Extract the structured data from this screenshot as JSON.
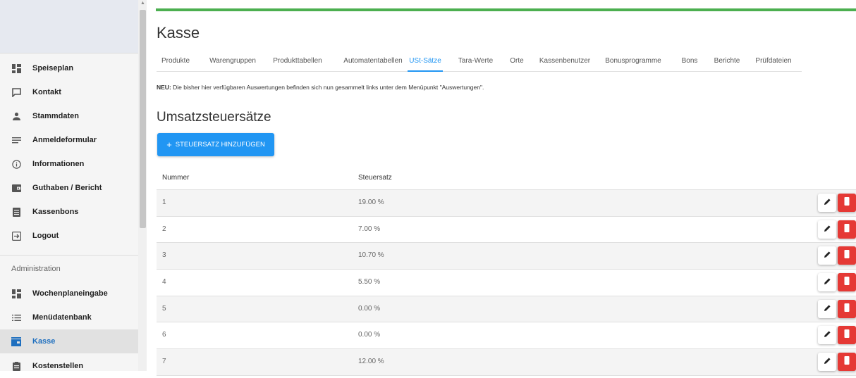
{
  "sidebar": {
    "items": [
      {
        "label": "Speiseplan",
        "icon": "dashboard-icon"
      },
      {
        "label": "Kontakt",
        "icon": "chat-icon"
      },
      {
        "label": "Stammdaten",
        "icon": "person-icon"
      },
      {
        "label": "Anmeldeformular",
        "icon": "notes-icon"
      },
      {
        "label": "Informationen",
        "icon": "info-icon"
      },
      {
        "label": "Guthaben / Bericht",
        "icon": "wallet-icon"
      },
      {
        "label": "Kassenbons",
        "icon": "receipt-icon"
      },
      {
        "label": "Logout",
        "icon": "logout-icon"
      }
    ],
    "section_label": "Administration",
    "admin_items": [
      {
        "label": "Wochenplaneingabe",
        "icon": "dashboard-icon"
      },
      {
        "label": "Menüdatenbank",
        "icon": "list-icon"
      },
      {
        "label": "Kasse",
        "icon": "store-icon"
      },
      {
        "label": "Kostenstellen",
        "icon": "clipboard-icon"
      }
    ],
    "active_item": "Kasse"
  },
  "progress": {
    "value": 100,
    "color": "#4caf50"
  },
  "page": {
    "title": "Kasse"
  },
  "tabs": [
    {
      "label": "Produkte"
    },
    {
      "label": "Warengruppen"
    },
    {
      "label": "Produkttabellen"
    },
    {
      "label": "Automatentabellen"
    },
    {
      "label": "USt-Sätze",
      "active": true
    },
    {
      "label": "Tara-Werte"
    },
    {
      "label": "Orte"
    },
    {
      "label": "Kassenbenutzer"
    },
    {
      "label": "Bonusprogramme"
    },
    {
      "label": "Bons"
    },
    {
      "label": "Berichte"
    },
    {
      "label": "Prüfdateien"
    }
  ],
  "notice": {
    "prefix": "NEU:",
    "text": "Die bisher hier verfügbaren Auswertungen befinden sich nun gesammelt links unter dem Menüpunkt \"Auswertungen\"."
  },
  "section": {
    "title": "Umsatzsteuersätze"
  },
  "add_button": {
    "label": "STEUERSATZ HINZUFÜGEN"
  },
  "table": {
    "columns": [
      "Nummer",
      "Steuersatz"
    ],
    "rows": [
      {
        "nummer": "1",
        "steuersatz": "19.00 %"
      },
      {
        "nummer": "2",
        "steuersatz": "7.00 %"
      },
      {
        "nummer": "3",
        "steuersatz": "10.70 %"
      },
      {
        "nummer": "4",
        "steuersatz": "5.50 %"
      },
      {
        "nummer": "5",
        "steuersatz": "0.00 %"
      },
      {
        "nummer": "6",
        "steuersatz": "0.00 %"
      },
      {
        "nummer": "7",
        "steuersatz": "12.00 %"
      }
    ]
  },
  "colors": {
    "accent": "#2196f3",
    "danger": "#e53935",
    "success": "#4caf50"
  }
}
